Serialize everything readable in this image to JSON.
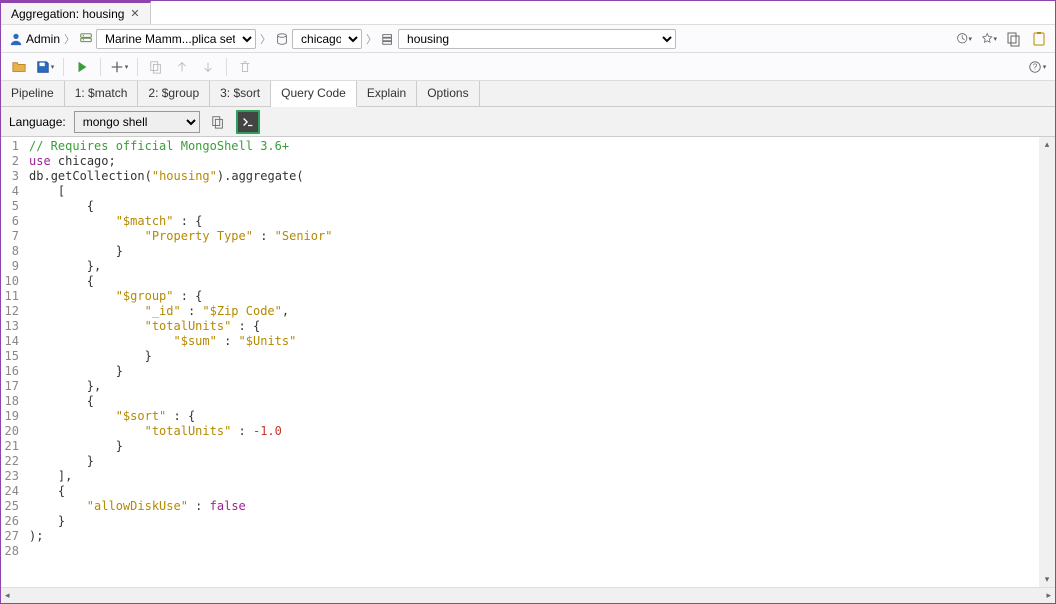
{
  "tab": {
    "title": "Aggregation: housing"
  },
  "breadcrumb": {
    "user": "Admin",
    "server": "Marine Mamm...plica set]",
    "database": "chicago",
    "collection": "housing"
  },
  "pipeline_tabs": [
    "Pipeline",
    "1: $match",
    "2: $group",
    "3: $sort",
    "Query Code",
    "Explain",
    "Options"
  ],
  "active_pipeline_tab": "Query Code",
  "lang": {
    "label": "Language:",
    "selected": "mongo shell"
  },
  "code": {
    "lines": [
      {
        "n": 1,
        "segs": [
          [
            "// Requires official MongoShell 3.6+",
            "cm"
          ]
        ]
      },
      {
        "n": 2,
        "segs": [
          [
            "use",
            "kw"
          ],
          [
            " ",
            "punc"
          ],
          [
            "chicago",
            "id"
          ],
          [
            ";",
            "punc"
          ]
        ]
      },
      {
        "n": 3,
        "segs": [
          [
            "db",
            "id"
          ],
          [
            ".",
            "punc"
          ],
          [
            "getCollection",
            "fn"
          ],
          [
            "(",
            "punc"
          ],
          [
            "\"housing\"",
            "str"
          ],
          [
            ")",
            "punc"
          ],
          [
            ".",
            "punc"
          ],
          [
            "aggregate",
            "fn"
          ],
          [
            "(",
            "punc"
          ]
        ]
      },
      {
        "n": 4,
        "segs": [
          [
            "    [",
            "punc"
          ]
        ]
      },
      {
        "n": 5,
        "segs": [
          [
            "        {",
            "punc"
          ]
        ]
      },
      {
        "n": 6,
        "segs": [
          [
            "            ",
            "punc"
          ],
          [
            "\"$match\"",
            "key"
          ],
          [
            " : {",
            "punc"
          ]
        ]
      },
      {
        "n": 7,
        "segs": [
          [
            "                ",
            "punc"
          ],
          [
            "\"Property Type\"",
            "key"
          ],
          [
            " : ",
            "punc"
          ],
          [
            "\"Senior\"",
            "str"
          ]
        ]
      },
      {
        "n": 8,
        "segs": [
          [
            "            }",
            "punc"
          ]
        ]
      },
      {
        "n": 9,
        "segs": [
          [
            "        },",
            "punc"
          ]
        ]
      },
      {
        "n": 10,
        "segs": [
          [
            "        {",
            "punc"
          ]
        ]
      },
      {
        "n": 11,
        "segs": [
          [
            "            ",
            "punc"
          ],
          [
            "\"$group\"",
            "key"
          ],
          [
            " : {",
            "punc"
          ]
        ]
      },
      {
        "n": 12,
        "segs": [
          [
            "                ",
            "punc"
          ],
          [
            "\"_id\"",
            "key"
          ],
          [
            " : ",
            "punc"
          ],
          [
            "\"$Zip Code\"",
            "str"
          ],
          [
            ",",
            "punc"
          ]
        ]
      },
      {
        "n": 13,
        "segs": [
          [
            "                ",
            "punc"
          ],
          [
            "\"totalUnits\"",
            "key"
          ],
          [
            " : {",
            "punc"
          ]
        ]
      },
      {
        "n": 14,
        "segs": [
          [
            "                    ",
            "punc"
          ],
          [
            "\"$sum\"",
            "key"
          ],
          [
            " : ",
            "punc"
          ],
          [
            "\"$Units\"",
            "str"
          ]
        ]
      },
      {
        "n": 15,
        "segs": [
          [
            "                }",
            "punc"
          ]
        ]
      },
      {
        "n": 16,
        "segs": [
          [
            "            }",
            "punc"
          ]
        ]
      },
      {
        "n": 17,
        "segs": [
          [
            "        },",
            "punc"
          ]
        ]
      },
      {
        "n": 18,
        "segs": [
          [
            "        {",
            "punc"
          ]
        ]
      },
      {
        "n": 19,
        "segs": [
          [
            "            ",
            "punc"
          ],
          [
            "\"$sort\"",
            "key"
          ],
          [
            " : {",
            "punc"
          ]
        ]
      },
      {
        "n": 20,
        "segs": [
          [
            "                ",
            "punc"
          ],
          [
            "\"totalUnits\"",
            "key"
          ],
          [
            " : ",
            "punc"
          ],
          [
            "-1.0",
            "num"
          ]
        ]
      },
      {
        "n": 21,
        "segs": [
          [
            "            }",
            "punc"
          ]
        ]
      },
      {
        "n": 22,
        "segs": [
          [
            "        }",
            "punc"
          ]
        ]
      },
      {
        "n": 23,
        "segs": [
          [
            "    ],",
            "punc"
          ]
        ]
      },
      {
        "n": 24,
        "segs": [
          [
            "    {",
            "punc"
          ]
        ]
      },
      {
        "n": 25,
        "segs": [
          [
            "        ",
            "punc"
          ],
          [
            "\"allowDiskUse\"",
            "key"
          ],
          [
            " : ",
            "punc"
          ],
          [
            "false",
            "bool"
          ]
        ]
      },
      {
        "n": 26,
        "segs": [
          [
            "    }",
            "punc"
          ]
        ]
      },
      {
        "n": 27,
        "segs": [
          [
            ");",
            "punc"
          ]
        ]
      },
      {
        "n": 28,
        "segs": [
          [
            "",
            "punc"
          ]
        ]
      }
    ]
  }
}
